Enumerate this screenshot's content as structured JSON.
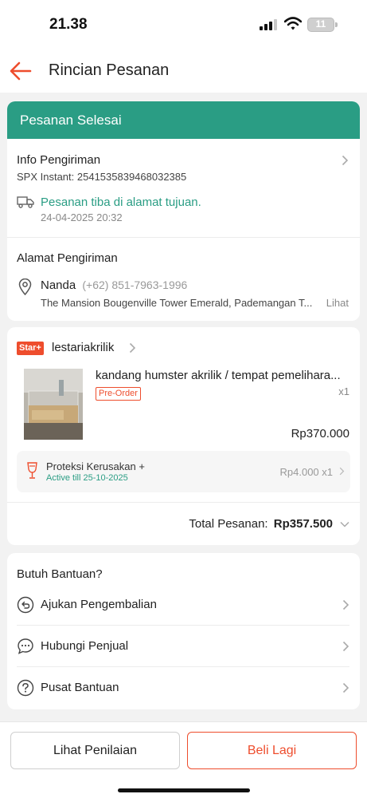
{
  "status_bar": {
    "time": "21.38",
    "battery": "11"
  },
  "header": {
    "title": "Rincian Pesanan"
  },
  "order_status": {
    "label": "Pesanan Selesai"
  },
  "shipping_info": {
    "title": "Info Pengiriman",
    "tracking": "SPX Instant: 2541535839468032385",
    "event": "Pesanan tiba di alamat tujuan.",
    "event_time": "24-04-2025 20:32"
  },
  "address": {
    "title": "Alamat Pengiriman",
    "name": "Nanda",
    "phone": "(+62) 851-7963-1996",
    "line": "The Mansion Bougenville Tower Emerald, Pademangan T...",
    "more_label": "Lihat"
  },
  "shop": {
    "badge": "Star+",
    "name": "lestariakrilik",
    "product": {
      "title": "kandang humster akrilik / tempat pemelihara...",
      "tag": "Pre-Order",
      "qty": "x1",
      "price": "Rp370.000"
    },
    "protection": {
      "title": "Proteksi Kerusakan +",
      "validity": "Active till 25-10-2025",
      "price": "Rp4.000 x1"
    },
    "total_label": "Total Pesanan:",
    "total_value": "Rp357.500"
  },
  "help": {
    "title": "Butuh Bantuan?",
    "items": [
      {
        "label": "Ajukan Pengembalian",
        "icon": "return-icon"
      },
      {
        "label": "Hubungi Penjual",
        "icon": "chat-icon"
      },
      {
        "label": "Pusat Bantuan",
        "icon": "help-icon"
      }
    ]
  },
  "actions": {
    "rate_label": "Lihat Penilaian",
    "buy_again_label": "Beli Lagi"
  },
  "colors": {
    "accent": "#ee4d2d",
    "status_green": "#2a9d84"
  }
}
